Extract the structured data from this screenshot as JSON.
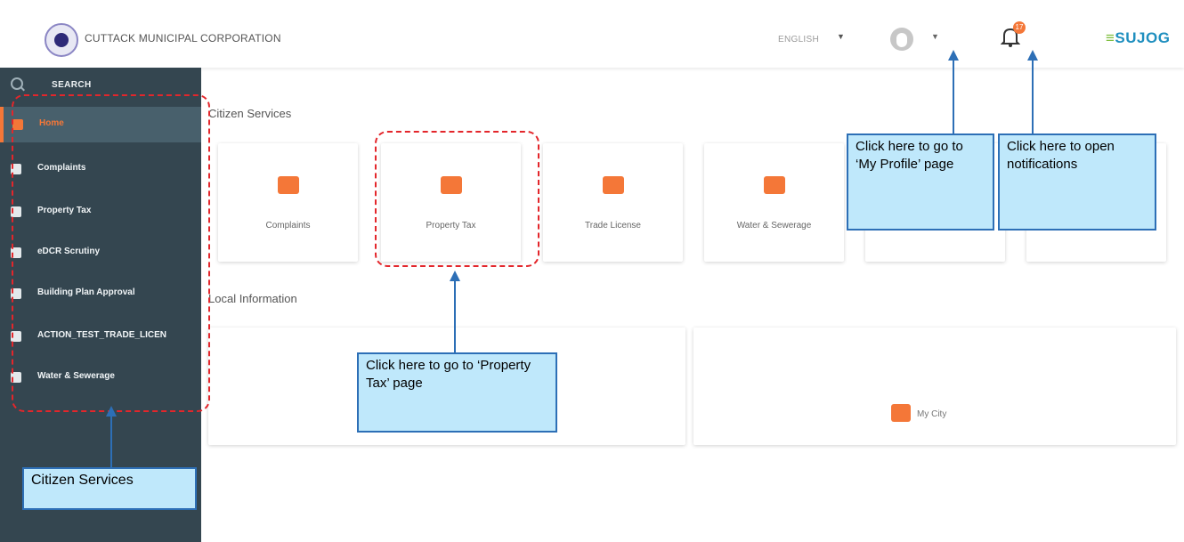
{
  "header": {
    "org_name": "CUTTACK MUNICIPAL CORPORATION",
    "language": "ENGLISH",
    "notification_count": "17",
    "brand": "SUJOG"
  },
  "sidebar": {
    "search_label": "SEARCH",
    "items": [
      {
        "label": "Home",
        "icon": "home-icon"
      },
      {
        "label": "Complaints",
        "icon": "complaints-icon"
      },
      {
        "label": "Property Tax",
        "icon": "property-tax-icon"
      },
      {
        "label": "eDCR Scrutiny",
        "icon": "edcr-icon"
      },
      {
        "label": "Building Plan Approval",
        "icon": "building-plan-icon"
      },
      {
        "label": "ACTION_TEST_TRADE_LICEN",
        "icon": "trade-license-icon"
      },
      {
        "label": "Water & Sewerage",
        "icon": "water-tap-icon"
      }
    ]
  },
  "main": {
    "citizen_services_title": "Citizen Services",
    "cards": [
      {
        "label": "Complaints",
        "icon": "complaints-icon"
      },
      {
        "label": "Property Tax",
        "icon": "property-tax-icon"
      },
      {
        "label": "Trade License",
        "icon": "briefcase-icon"
      },
      {
        "label": "Water & Sewerage",
        "icon": "water-tap-icon"
      },
      {
        "label": "",
        "icon": ""
      },
      {
        "label": "",
        "icon": ""
      }
    ],
    "local_info_title": "Local Information",
    "my_city_label": "My City"
  },
  "annotations": {
    "profile": "Click here to go to ‘My Profile’ page",
    "notifications": "Click here to open notifications",
    "property_tax": "Click here to go to ‘Property Tax’ page",
    "citizen_services": "Citizen Services"
  },
  "colors": {
    "accent": "#f47738",
    "sidebar_bg": "#344650",
    "callout_bg": "#bfe8fb",
    "callout_border": "#2d6fb6",
    "highlight_dash": "#e3262b",
    "brand": "#1f8fbf"
  }
}
